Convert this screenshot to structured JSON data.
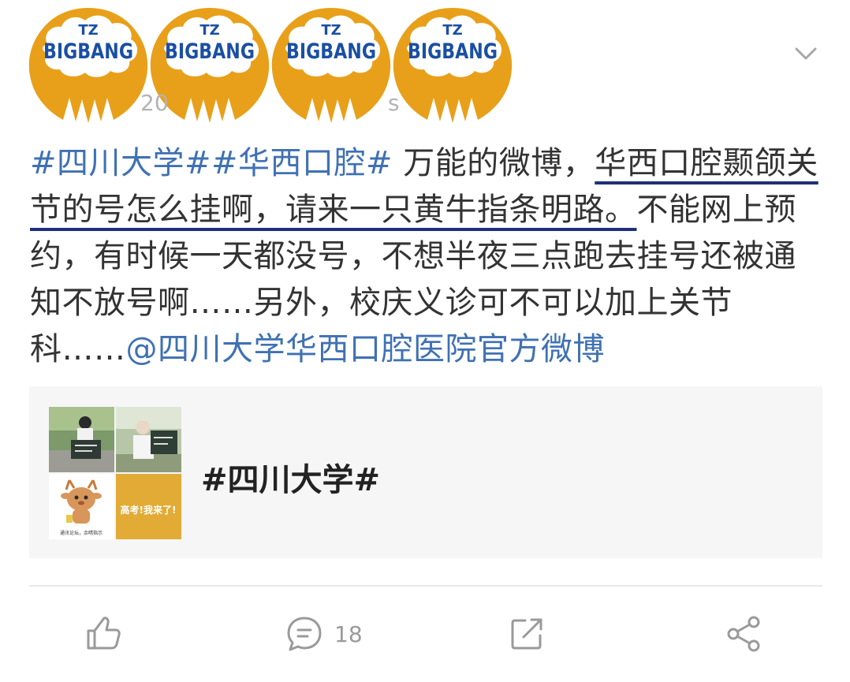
{
  "watermark": {
    "logo_top_text": "TZ",
    "logo_main_text": "BIGBANG",
    "count": 4
  },
  "header": {
    "meta_fragment_left": "20",
    "meta_fragment_right": "s"
  },
  "post": {
    "tag_1": "#四川大学#",
    "tag_2": "#华西口腔#",
    "text_plain_1": " 万能的微博，",
    "text_underlined": "华西口腔颞颌关节的号怎么挂啊，请来一只黄牛指条明路。",
    "text_plain_2": "不能网上预约，有时候一天都没号，不想半夜三点跑去挂号还被通知不放号啊……另外，校庆义诊可不可以加上关节科……",
    "mention": "@四川大学华西口腔医院官方微博"
  },
  "topic_card": {
    "title": "#四川大学#",
    "thumbs": [
      {
        "name": "thumb-student-sign"
      },
      {
        "name": "thumb-graduate-sign"
      },
      {
        "name": "thumb-deer-mascot",
        "caption": "通讯论坛，余晴指示"
      },
      {
        "name": "thumb-gaokao-banner",
        "text": "高考!我来了!"
      }
    ]
  },
  "actions": {
    "like_icon": "thumbs-up-icon",
    "comment_icon": "comment-icon",
    "comment_count": "18",
    "repost_icon": "repost-icon",
    "share_icon": "share-icon"
  },
  "colors": {
    "link": "#3f71b3",
    "underline": "#1f2f7a",
    "logo_orange": "#e8a01a",
    "logo_blue": "#1a4fa3",
    "card_bg": "#f6f6f6",
    "icon_gray": "#9a9a9a"
  }
}
